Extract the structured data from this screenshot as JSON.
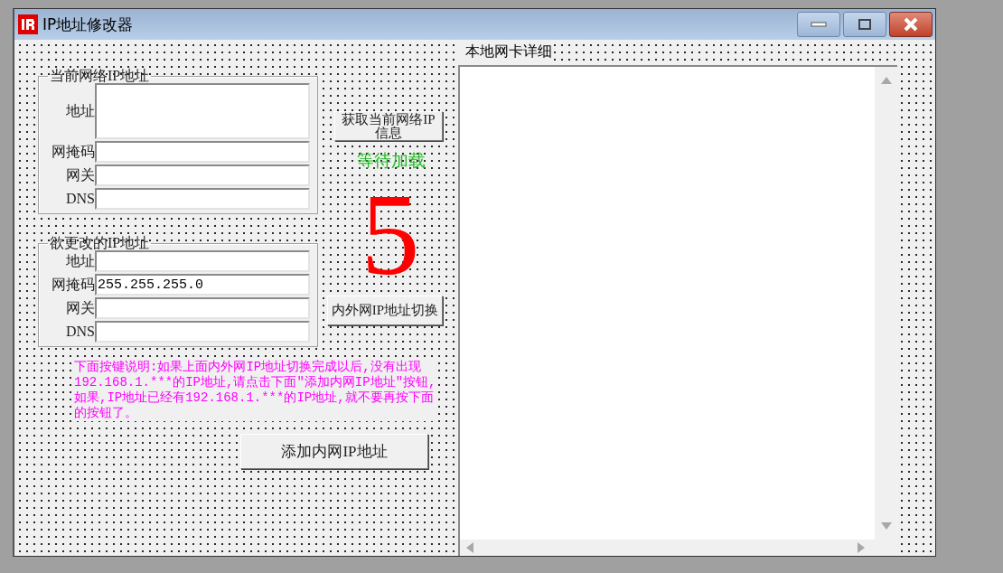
{
  "window": {
    "title": "IP地址修改器"
  },
  "current_group": {
    "title": "当前网络IP地址",
    "fields": [
      {
        "label": "地址",
        "kind": "multiline"
      },
      {
        "label": "网掩码",
        "kind": "line"
      },
      {
        "label": "网关",
        "kind": "line"
      },
      {
        "label": "DNS",
        "kind": "line"
      }
    ]
  },
  "change_group": {
    "title": "欲更改的IP地址",
    "fields": [
      {
        "label": "地址",
        "kind": "line"
      },
      {
        "label": "网掩码",
        "kind": "line",
        "value": "255.255.255.0"
      },
      {
        "label": "网关",
        "kind": "line"
      },
      {
        "label": "DNS",
        "kind": "line"
      }
    ]
  },
  "get_info_button": "获取当前网络IP信息",
  "status": "等待加载",
  "countdown": "5",
  "switch_button": "内外网IP地址切换",
  "note": "下面按键说明:如果上面内外网IP地址切换完成以后,没有出现192.168.1.***的IP地址,请点击下面\"添加内网IP地址\"按钮,如果,IP地址已经有192.168.1.***的IP地址,就不要再按下面的按钮了。",
  "add_button": "添加内网IP地址",
  "details_label": "本地网卡详细"
}
